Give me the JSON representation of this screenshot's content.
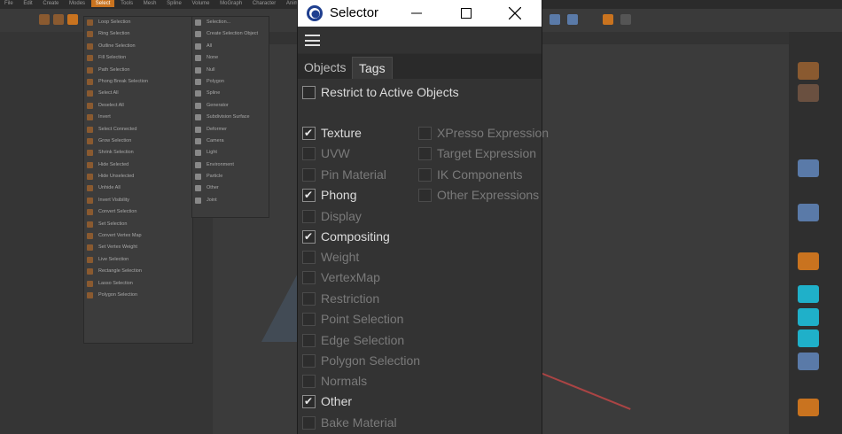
{
  "background": {
    "menubar": [
      "File",
      "Edit",
      "Create",
      "Modes",
      "Select",
      "Tools",
      "Mesh",
      "Spline",
      "Volume",
      "MoGraph",
      "Character",
      "Animate"
    ],
    "menu_items": [
      "Loop Selection",
      "Ring Selection",
      "Outline Selection",
      "Fill Selection",
      "Path Selection",
      "Phong Break Selection",
      "Select All",
      "Deselect All",
      "Invert",
      "Select Connected",
      "Grow Selection",
      "Shrink Selection",
      "Hide Selected",
      "Hide Unselected",
      "Unhide All",
      "Invert Visibility",
      "Convert Selection",
      "Set Selection",
      "Convert Vertex Map",
      "Set Vertex Weight",
      "Live Selection",
      "Rectangle Selection",
      "Lasso Selection",
      "Polygon Selection"
    ],
    "submenu_items": [
      "Selection...",
      "Create Selection Object",
      "All",
      "None",
      "Null",
      "Polygon",
      "Spline",
      "Generator",
      "Subdivision Surface",
      "Deformer",
      "Camera",
      "Light",
      "Environment",
      "Particle",
      "Other",
      "Joint"
    ]
  },
  "window": {
    "title": "Selector",
    "minimize_glyph": "—",
    "maximize_glyph": "☐",
    "close_glyph": "✕"
  },
  "tabs": [
    {
      "label": "Objects",
      "active": false
    },
    {
      "label": "Tags",
      "active": true
    }
  ],
  "restrict": {
    "label": "Restrict to Active Objects",
    "checked": false
  },
  "left_tags": [
    {
      "label": "Texture",
      "checked": true
    },
    {
      "label": "UVW",
      "checked": false
    },
    {
      "label": "Pin Material",
      "checked": false
    },
    {
      "label": "Phong",
      "checked": true
    },
    {
      "label": "Display",
      "checked": false
    },
    {
      "label": "Compositing",
      "checked": true
    },
    {
      "label": "Weight",
      "checked": false
    },
    {
      "label": "VertexMap",
      "checked": false
    },
    {
      "label": "Restriction",
      "checked": false
    },
    {
      "label": "Point Selection",
      "checked": false
    },
    {
      "label": "Edge Selection",
      "checked": false
    },
    {
      "label": "Polygon Selection",
      "checked": false
    },
    {
      "label": "Normals",
      "checked": false
    },
    {
      "label": "Other",
      "checked": true
    },
    {
      "label": "Bake Material",
      "checked": false
    }
  ],
  "right_tags": [
    {
      "label": "XPresso Expression",
      "checked": false
    },
    {
      "label": "Target Expression",
      "checked": false
    },
    {
      "label": "IK Components",
      "checked": false
    },
    {
      "label": "Other Expressions",
      "checked": false
    }
  ],
  "check_glyph": "✔",
  "colors": {
    "accent": "#c9731f",
    "checked_text": "#dcdcdc",
    "unchecked_text": "#7a7a7a"
  }
}
